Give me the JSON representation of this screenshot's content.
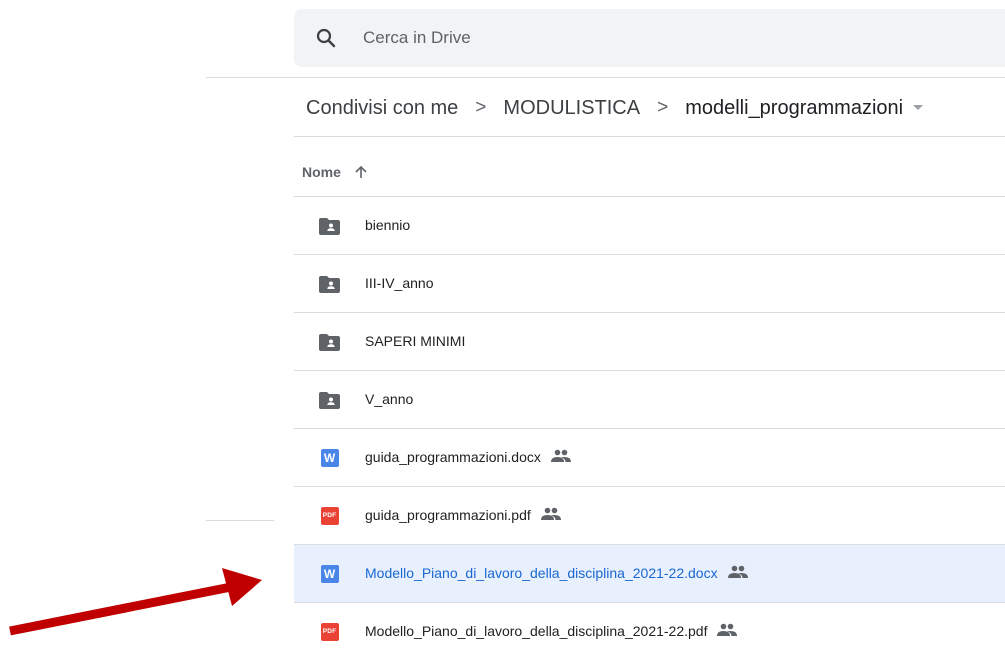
{
  "search": {
    "placeholder": "Cerca in Drive",
    "icon": "search-icon"
  },
  "breadcrumb": {
    "items": [
      "Condivisi con me",
      "MODULISTICA",
      "modelli_programmazioni"
    ],
    "separator": ">"
  },
  "list_header": {
    "name_label": "Nome",
    "sort": "ascending"
  },
  "files": [
    {
      "name": "biennio",
      "type": "shared-folder",
      "shared": false,
      "selected": false
    },
    {
      "name": "III-IV_anno",
      "type": "shared-folder",
      "shared": false,
      "selected": false
    },
    {
      "name": "SAPERI MINIMI",
      "type": "shared-folder",
      "shared": false,
      "selected": false
    },
    {
      "name": "V_anno",
      "type": "shared-folder",
      "shared": false,
      "selected": false
    },
    {
      "name": "guida_programmazioni.docx",
      "type": "word",
      "shared": true,
      "selected": false
    },
    {
      "name": "guida_programmazioni.pdf",
      "type": "pdf",
      "shared": true,
      "selected": false
    },
    {
      "name": "Modello_Piano_di_lavoro_della_disciplina_2021-22.docx",
      "type": "word",
      "shared": true,
      "selected": true
    },
    {
      "name": "Modello_Piano_di_lavoro_della_disciplina_2021-22.pdf",
      "type": "pdf",
      "shared": true,
      "selected": false
    }
  ],
  "icons": {
    "word_letter": "W",
    "pdf_label": "PDF"
  },
  "colors": {
    "selected_bg": "#e8f0fe",
    "selected_text": "#1967d2",
    "word_blue": "#4a86e8",
    "pdf_red": "#ea4335",
    "arrow_red": "#c00000"
  }
}
